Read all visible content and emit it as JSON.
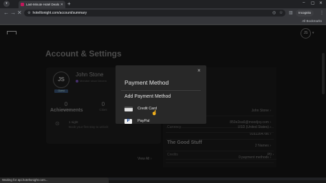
{
  "browser": {
    "tab_title": "Last-Minute Hotel Deals at Gre...",
    "url": "hotelltonight.com/account/summary",
    "incognito_label": "Incognito",
    "all_bookmarks": "All Bookmarks",
    "status_text": "Waiting for api.hoteltonight.com..."
  },
  "header": {
    "avatar_initials": "JS"
  },
  "page": {
    "title": "Account & Settings"
  },
  "profile": {
    "initials": "JS",
    "badge": "Guest",
    "name": "John Stone",
    "member_since": "Member since Decem",
    "stats": [
      {
        "value": "0",
        "label": "Nights"
      },
      {
        "value": "0",
        "label": "Cities"
      }
    ]
  },
  "achievements": {
    "title": "Achievements",
    "item_title": "1 night",
    "item_desc": "Book your first stay to unlock",
    "view_all": "View All"
  },
  "details": {
    "rows": [
      {
        "key": "",
        "value": "John Stone"
      },
      {
        "key": "",
        "value": "850e2ea6@moodjoy.com"
      },
      {
        "key": "",
        "value": "9162264786"
      },
      {
        "key": "",
        "value": "2 Names"
      },
      {
        "key": "",
        "value": "0 payment methods"
      },
      {
        "key": "Currency",
        "value": "USD (United States)"
      }
    ]
  },
  "good_stuff": {
    "title": "The Good Stuff",
    "credits_label": "Credits",
    "credits_value": "P0"
  },
  "modal": {
    "title": "Payment Method",
    "close": "×",
    "subtitle": "Add Payment Method",
    "options": [
      {
        "label": "Credit Card",
        "icon": "credit-card-icon"
      },
      {
        "label": "PayPal",
        "icon": "paypal-icon"
      }
    ]
  }
}
